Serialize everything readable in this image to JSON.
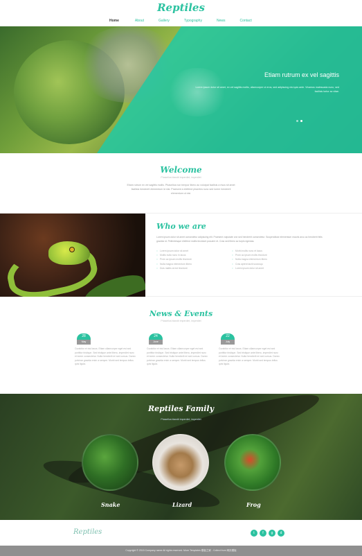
{
  "site": {
    "logo": "Reptiles"
  },
  "nav": {
    "items": [
      {
        "label": "Home",
        "active": true
      },
      {
        "label": "About",
        "active": false
      },
      {
        "label": "Gallery",
        "active": false
      },
      {
        "label": "Typography",
        "active": false
      },
      {
        "label": "News",
        "active": false
      },
      {
        "label": "Contact",
        "active": false
      }
    ]
  },
  "hero": {
    "title": "Etiam rutrum ex vel sagittis",
    "text": "Lorem ipsum dolor sit amet, ex vel sagittis mollis, ullamcorper ut eros, sed adipiscing nisi quis ante. Vivamus malesuada nunc, sed facilisis tortor ac vitae.",
    "slides": 2,
    "active_slide": 1
  },
  "welcome": {
    "title": "Welcome",
    "subtitle": "Phasellus blandit imperdiet, imperdiet",
    "text": "Etiam rutrum ex vel sagittis mollis. Phasellus non tempor libero ac volutpat facilisis a risus sit amet facilisis hendrerit elementum id nisi. Praesent a eleifend pharetra nunc sed lorem hendrerit elementum ut nisi."
  },
  "who": {
    "title": "Who we are",
    "text": "Lorem ipsum dolor sit amet consectetur adipiscing elit. Praesent vulputate orci sed hendrerit consectetur. Suspendisse elementum mauris arcu ac hendrerit felis gravida id. Pellentesque eleifend mollis tincidunt posuere et. Cras sed libero ac turpis egestas.",
    "list_left": [
      "Lorem ipsum dolor sit amet",
      "Mollis nulla nunc in lacus",
      "Proin ac ipsum mollis tincidunt",
      "Nulla magna elementum libero",
      "Duis mattis at est tincidunt"
    ],
    "list_right": [
      "Morbi mollis nunc et lacus",
      "Proin ac ipsum mollis tincidunt",
      "Nulla magna elementum libero",
      "Cras aptent taciti sociosqu",
      "Lorem ipsum dolor sit amet"
    ]
  },
  "news": {
    "title": "News & Events",
    "subtitle": "Phasellus blandit imperdiet, imperdiet",
    "events": [
      {
        "day": "28",
        "month": "May",
        "text": "Curabitur et nisl lacus. Etiam ullamcorper eget est sed porttitor tristique. Sed tristique ante libero, imperdiet nunc et lorem consectetur. Nulla hendrerit mi sed cursus. Donec pulvinar gravida enim a semper. Morbi sed tempus tellus quis ligula."
      },
      {
        "day": "24",
        "month": "June",
        "text": "Curabitur et nisl lacus. Etiam ullamcorper eget est sed porttitor tristique. Sed tristique ante libero, imperdiet nunc et lorem consectetur. Nulla hendrerit mi sed cursus. Donec pulvinar gravida enim a semper. Morbi sed tempus tellus quis ligula."
      },
      {
        "day": "22",
        "month": "July",
        "text": "Curabitur et nisl lacus. Etiam ullamcorper eget est sed porttitor tristique. Sed tristique ante libero, imperdiet nunc et lorem consectetur. Nulla hendrerit mi sed cursus. Donec pulvinar gravida enim a semper. Morbi sed tempus tellus quis ligula."
      }
    ]
  },
  "family": {
    "title": "Reptiles Family",
    "subtitle": "Phasellus blandit imperdiet, imperdiet",
    "items": [
      {
        "label": "Snake"
      },
      {
        "label": "Lizard"
      },
      {
        "label": "Frog"
      }
    ]
  },
  "footer": {
    "logo": "Reptiles",
    "social": [
      {
        "icon": "twitter-icon",
        "glyph": "t"
      },
      {
        "icon": "facebook-icon",
        "glyph": "f"
      },
      {
        "icon": "google-plus-icon",
        "glyph": "g"
      },
      {
        "icon": "dribbble-icon",
        "glyph": "d"
      }
    ],
    "copyright": "Copyright © 2015 Company name All rights reserved. More Templates 模板之家 - Collect from 网页模板"
  },
  "colors": {
    "accent": "#2bc2a0",
    "footer_bar": "#8f8f8f"
  }
}
